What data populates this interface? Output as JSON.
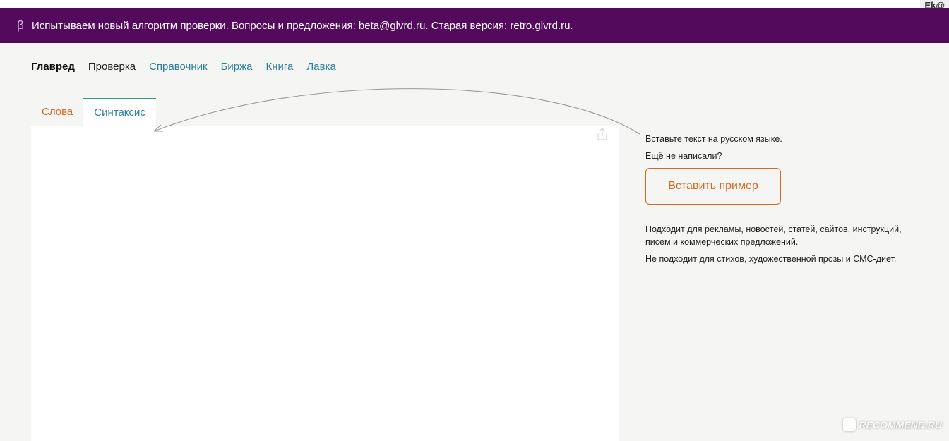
{
  "corner_tag": "Ek@",
  "banner": {
    "beta_mark": "β",
    "text_prefix": "Испытываем новый алгоритм проверки. Вопросы и предложения: ",
    "email_link": "beta@glvrd.ru",
    "text_middle": ". Старая версия: ",
    "retro_link": "retro.glvrd.ru",
    "text_suffix": "."
  },
  "nav": {
    "brand": "Главред",
    "items": [
      {
        "label": "Проверка",
        "active": true
      },
      {
        "label": "Справочник",
        "active": false
      },
      {
        "label": "Биржа",
        "active": false
      },
      {
        "label": "Книга",
        "active": false
      },
      {
        "label": "Лавка",
        "active": false
      }
    ]
  },
  "tabs": {
    "words": "Слова",
    "syntax": "Синтаксис"
  },
  "editor": {
    "value": "",
    "share_icon": "share-icon"
  },
  "sidebar": {
    "hint_paste": "Вставьте текст на русском языке.",
    "hint_not_written": "Ещё не написали?",
    "example_button": "Вставить пример",
    "suits": "Подходит для рекламы, новостей, статей, сайтов, инструкций, писем и коммерческих предложений.",
    "not_suits": "Не подходит для стихов, художественной прозы и СМС-диет."
  },
  "watermark": {
    "text": "RECOMMEND.RU"
  },
  "colors": {
    "banner_bg": "#540a5c",
    "link": "#2a7f9a",
    "accent_orange": "#d2691e",
    "tab_border": "#2a9d8f",
    "page_bg": "#f5f5f4"
  }
}
